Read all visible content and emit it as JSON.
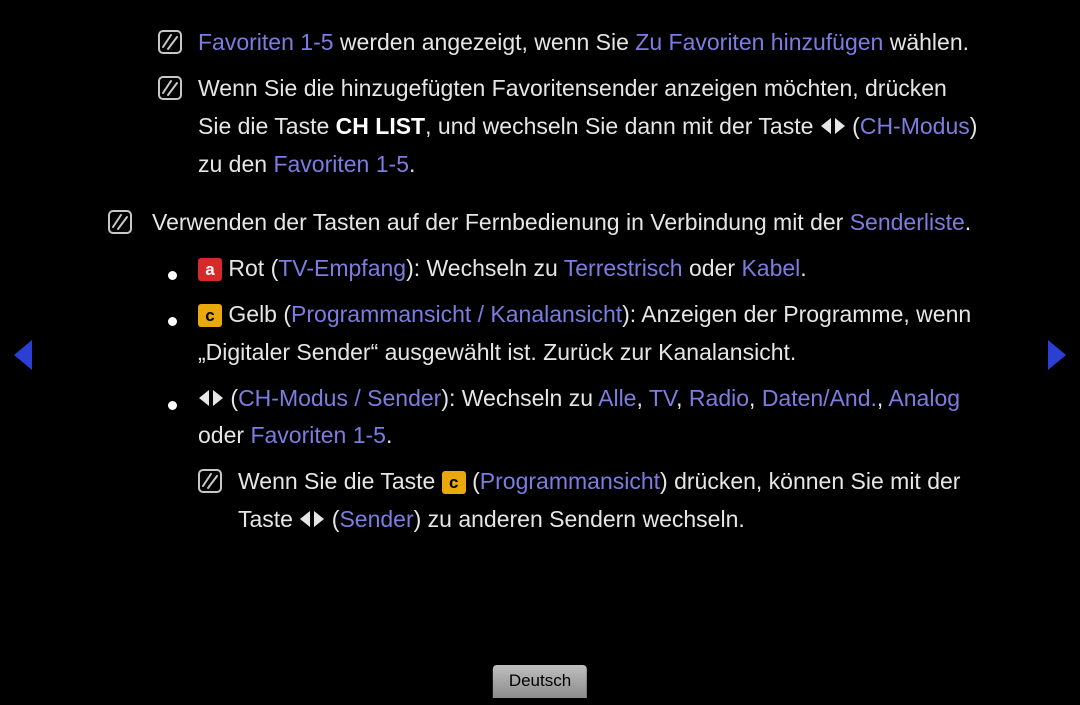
{
  "p1": {
    "t1": "Favoriten 1",
    "t2": "-",
    "t3": "5",
    "t4": " werden angezeigt, wenn Sie ",
    "t5": "Zu Favoriten hinzufügen",
    "t6": " wählen."
  },
  "p2": {
    "t1": "Wenn Sie die hinzugefügten Favoritensender anzeigen möchten, drücken Sie die Taste ",
    "t2": "CH LIST",
    "t3": ", und wechseln Sie dann mit der Taste ",
    "t4": " (",
    "t5": "CH-Modus",
    "t6": ") zu den ",
    "t7": "Favoriten 1",
    "t8": "-",
    "t9": "5",
    "t10": "."
  },
  "p3": {
    "t1": "Verwenden der Tasten auf der Fernbedienung in Verbindung mit der ",
    "t2": "Senderliste",
    "t3": "."
  },
  "p4": {
    "btn": "a",
    "t1": " Rot (",
    "t2": "TV-Empfang",
    "t3": "): Wechseln zu ",
    "t4": "Terrestrisch",
    "t5": " oder ",
    "t6": "Kabel",
    "t7": "."
  },
  "p5": {
    "btn": "c",
    "t1": " Gelb (",
    "t2": "Programmansicht / Kanalansicht",
    "t3": "): Anzeigen der Programme, wenn „Digitaler Sender“ ausgewählt ist. Zurück zur Kanalansicht."
  },
  "p6": {
    "t1": " (",
    "t2": "CH-Modus / Sender",
    "t3": "): Wechseln zu ",
    "t4": "Alle",
    "t5": ", ",
    "t6": "TV",
    "t7": ", ",
    "t8": "Radio",
    "t9": ", ",
    "t10": "Daten/And.",
    "t11": ", ",
    "t12": "Analog",
    "t13": " oder ",
    "t14": "Favoriten 1",
    "t15": "-",
    "t16": "5",
    "t17": "."
  },
  "p7": {
    "t1": "Wenn Sie die Taste ",
    "btn": "c",
    "t2": " (",
    "t3": "Programmansicht",
    "t4": ") drücken, können Sie mit der Taste ",
    "t5": " (",
    "t6": "Sender",
    "t7": ") zu anderen Sendern wechseln."
  },
  "footer": {
    "lang": "Deutsch"
  }
}
